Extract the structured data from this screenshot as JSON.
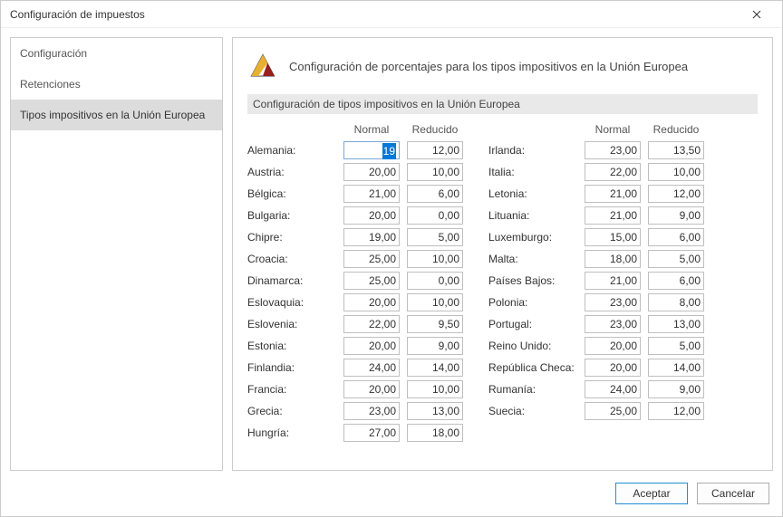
{
  "window": {
    "title": "Configuración de impuestos"
  },
  "sidebar": {
    "items": [
      {
        "label": "Configuración",
        "active": false
      },
      {
        "label": "Retenciones",
        "active": false
      },
      {
        "label": "Tipos impositivos en la Unión Europea",
        "active": true
      }
    ]
  },
  "main": {
    "title": "Configuración de porcentajes para los tipos impositivos en la Unión Europea",
    "section_header": "Configuración de tipos impositivos en la Unión Europea",
    "col_headers": {
      "normal": "Normal",
      "reducido": "Reducido"
    }
  },
  "chart_data": {
    "type": "table",
    "columns_left": [
      {
        "country": "Alemania:",
        "normal": "19",
        "reducido": "12,00",
        "selected": true
      },
      {
        "country": "Austria:",
        "normal": "20,00",
        "reducido": "10,00"
      },
      {
        "country": "Bélgica:",
        "normal": "21,00",
        "reducido": "6,00"
      },
      {
        "country": "Bulgaria:",
        "normal": "20,00",
        "reducido": "0,00"
      },
      {
        "country": "Chipre:",
        "normal": "19,00",
        "reducido": "5,00"
      },
      {
        "country": "Croacia:",
        "normal": "25,00",
        "reducido": "10,00"
      },
      {
        "country": "Dinamarca:",
        "normal": "25,00",
        "reducido": "0,00"
      },
      {
        "country": "Eslovaquia:",
        "normal": "20,00",
        "reducido": "10,00"
      },
      {
        "country": "Eslovenia:",
        "normal": "22,00",
        "reducido": "9,50"
      },
      {
        "country": "Estonia:",
        "normal": "20,00",
        "reducido": "9,00"
      },
      {
        "country": "Finlandia:",
        "normal": "24,00",
        "reducido": "14,00"
      },
      {
        "country": "Francia:",
        "normal": "20,00",
        "reducido": "10,00"
      },
      {
        "country": "Grecia:",
        "normal": "23,00",
        "reducido": "13,00"
      },
      {
        "country": "Hungría:",
        "normal": "27,00",
        "reducido": "18,00"
      }
    ],
    "columns_right": [
      {
        "country": "Irlanda:",
        "normal": "23,00",
        "reducido": "13,50"
      },
      {
        "country": "Italia:",
        "normal": "22,00",
        "reducido": "10,00"
      },
      {
        "country": "Letonia:",
        "normal": "21,00",
        "reducido": "12,00"
      },
      {
        "country": "Lituania:",
        "normal": "21,00",
        "reducido": "9,00"
      },
      {
        "country": "Luxemburgo:",
        "normal": "15,00",
        "reducido": "6,00"
      },
      {
        "country": "Malta:",
        "normal": "18,00",
        "reducido": "5,00"
      },
      {
        "country": "Países Bajos:",
        "normal": "21,00",
        "reducido": "6,00"
      },
      {
        "country": "Polonia:",
        "normal": "23,00",
        "reducido": "8,00"
      },
      {
        "country": "Portugal:",
        "normal": "23,00",
        "reducido": "13,00"
      },
      {
        "country": "Reino Unido:",
        "normal": "20,00",
        "reducido": "5,00"
      },
      {
        "country": "República Checa:",
        "normal": "20,00",
        "reducido": "14,00"
      },
      {
        "country": "Rumanía:",
        "normal": "24,00",
        "reducido": "9,00"
      },
      {
        "country": "Suecia:",
        "normal": "25,00",
        "reducido": "12,00"
      }
    ]
  },
  "footer": {
    "accept": "Aceptar",
    "cancel": "Cancelar"
  }
}
